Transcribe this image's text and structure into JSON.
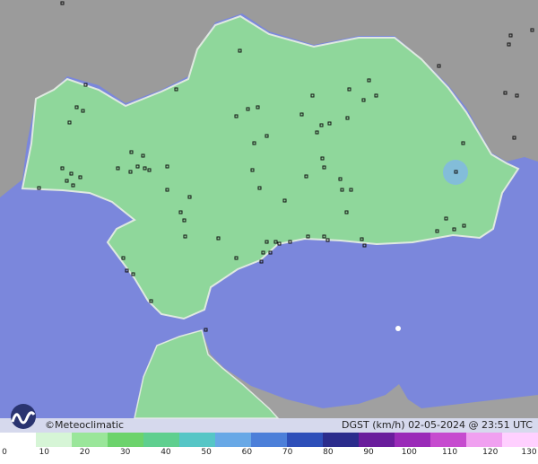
{
  "map": {
    "variable": "DGST",
    "unit": "(km/h)",
    "timestamp": "02-05-2024 @ 23:51 UTC",
    "credit": "Meteoclimatic",
    "credit_prefix": "©",
    "colors": {
      "sea": "#7b87dc",
      "land_outside": "#9a9a9a",
      "region": "#8fd79b",
      "region_border": "#dfe9e0"
    }
  },
  "legend": {
    "ticks": [
      "0",
      "10",
      "20",
      "30",
      "40",
      "50",
      "60",
      "70",
      "80",
      "90",
      "100",
      "110",
      "120",
      "130"
    ],
    "colors": [
      "#ffffff",
      "#d6f5d6",
      "#9ae69a",
      "#6cd36c",
      "#5fcf8f",
      "#56c6c6",
      "#68a8e6",
      "#4c7fd9",
      "#2e4fb9",
      "#2b2c8c",
      "#6a1d9c",
      "#9a2ab8",
      "#c64bcf",
      "#f0a0f0",
      "#ffd0ff"
    ]
  }
}
